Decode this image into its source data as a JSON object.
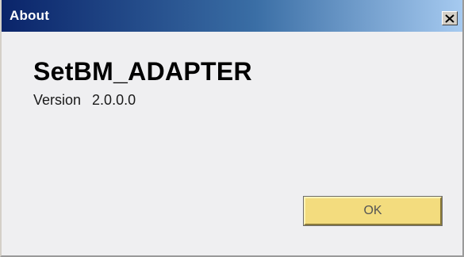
{
  "window": {
    "title": "About",
    "close_icon": "close-icon"
  },
  "about": {
    "app_name": "SetBM_ADAPTER",
    "version_label": "Version",
    "version_value": "2.0.0.0"
  },
  "buttons": {
    "ok_label": "OK"
  },
  "colors": {
    "titlebar_start": "#0a246a",
    "titlebar_end": "#a6caf0",
    "dialog_background": "#efeff1",
    "ok_button_background": "#f3dc7e"
  }
}
